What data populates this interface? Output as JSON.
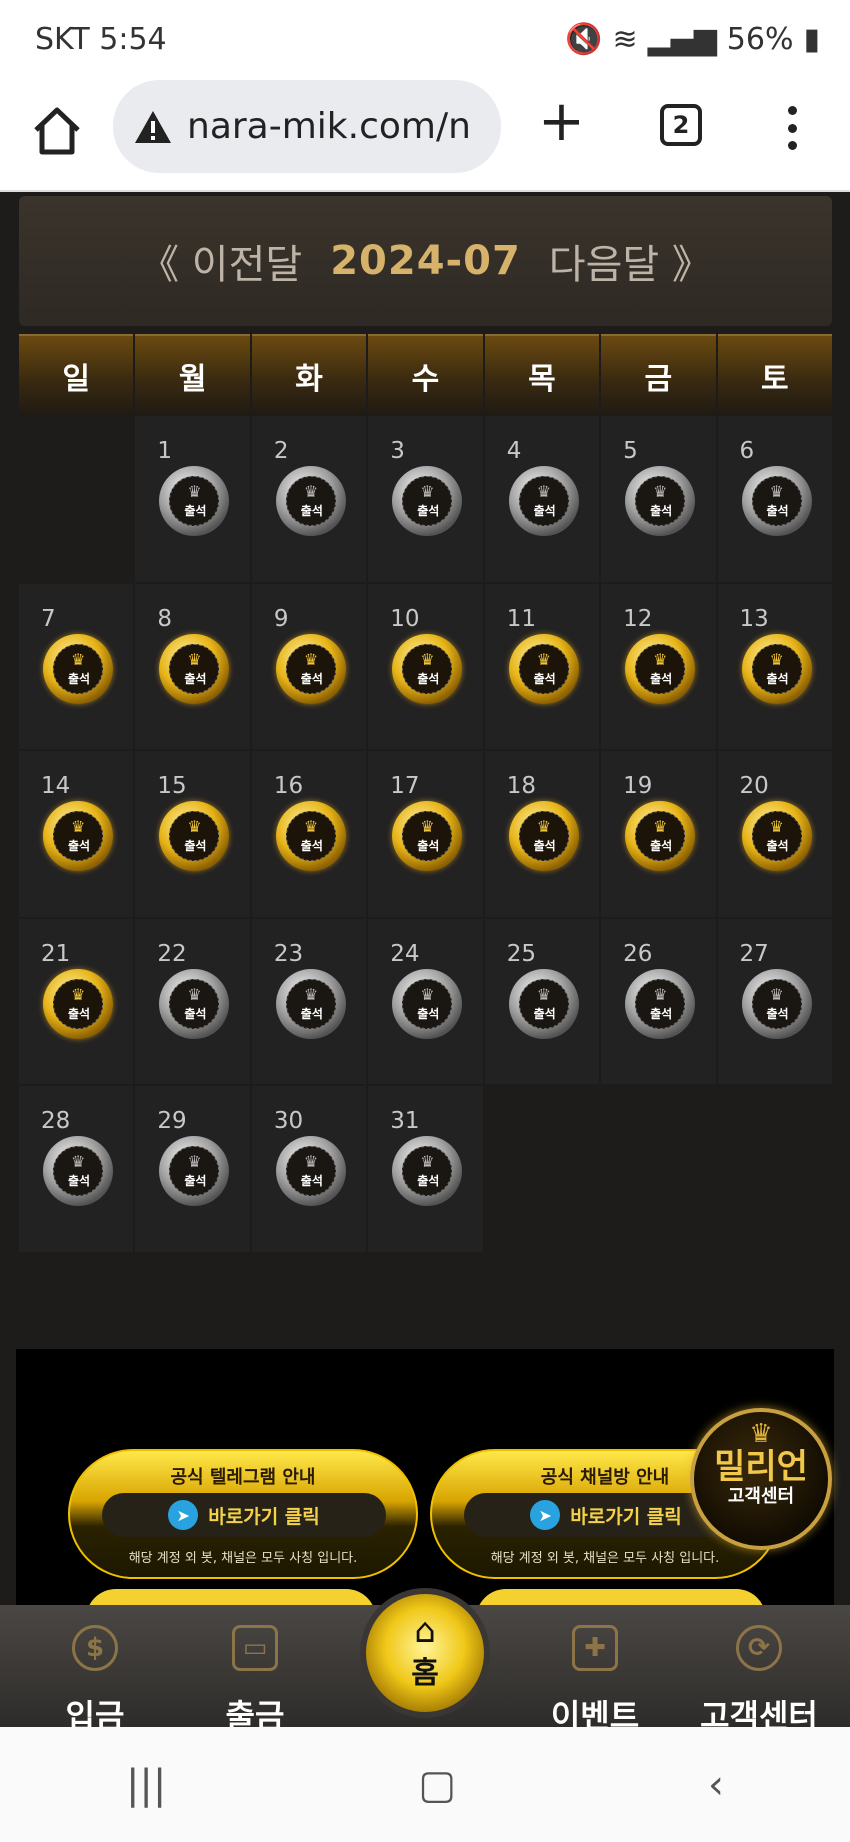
{
  "status_bar": {
    "carrier_time": "SKT 5:54",
    "battery": "56%"
  },
  "browser": {
    "url": "nara-mik.com/n",
    "tab_count": "2"
  },
  "calendar": {
    "prev_label": "《 이전달",
    "current_month": "2024-07",
    "next_label": "다음달 》",
    "weekdays": [
      "일",
      "월",
      "화",
      "수",
      "목",
      "금",
      "토"
    ],
    "badge_label": "출석",
    "first_weekday_index": 1,
    "days_in_month": 31,
    "attended_days": [
      7,
      8,
      9,
      10,
      11,
      12,
      13,
      14,
      15,
      16,
      17,
      18,
      19,
      20,
      21
    ]
  },
  "banner": {
    "left": {
      "title": "공식 텔레그램 안내",
      "button": "바로가기 클릭",
      "note": "해당 계정 외 봇, 채널은 모두 사칭 입니다."
    },
    "right": {
      "title": "공식 채널방 안내",
      "button": "바로가기 클릭",
      "note": "해당 계정 외 봇, 채널은 모두 사칭 입니다."
    }
  },
  "customer_center_badge": {
    "title": "밀리언",
    "subtitle": "고객센터"
  },
  "bottom_nav": {
    "deposit": "입금",
    "withdraw": "출금",
    "home": "홈",
    "event": "이벤트",
    "support": "고객센터"
  },
  "colors": {
    "gold": "#e7b417",
    "silver": "#a0a0a0",
    "accent_month": "#d6b26a"
  }
}
